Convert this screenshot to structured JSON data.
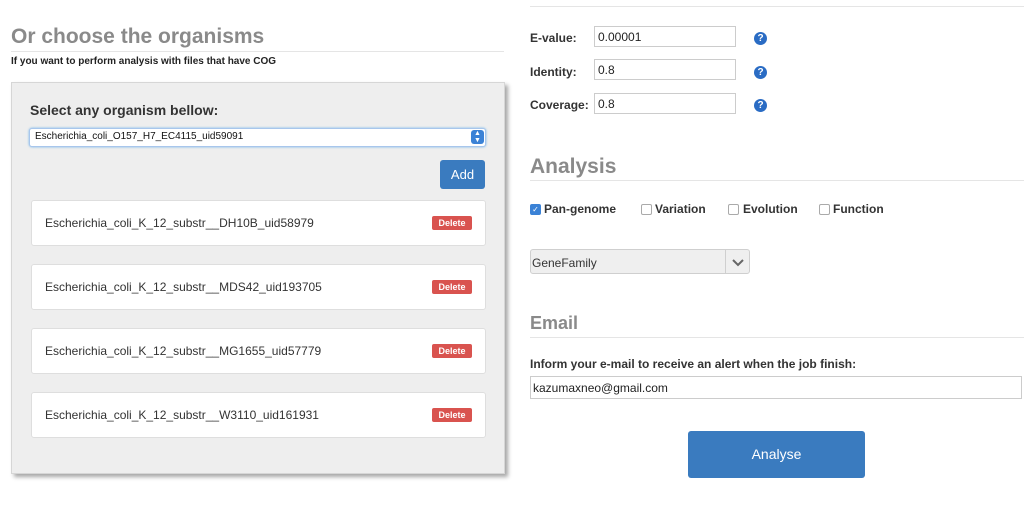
{
  "left": {
    "title": "Or choose the organisms",
    "subtitle": "If you want to perform analysis with files that have COG",
    "panel_label": "Select any organism bellow:",
    "selected_organism": "Escherichia_coli_O157_H7_EC4115_uid59091",
    "add_label": "Add",
    "delete_label": "Delete",
    "organisms": [
      "Escherichia_coli_K_12_substr__DH10B_uid58979",
      "Escherichia_coli_K_12_substr__MDS42_uid193705",
      "Escherichia_coli_K_12_substr__MG1655_uid57779",
      "Escherichia_coli_K_12_substr__W3110_uid161931"
    ]
  },
  "params": {
    "evalue_label": "E-value:",
    "evalue": "0.00001",
    "identity_label": "Identity:",
    "identity": "0.8",
    "coverage_label": "Coverage:",
    "coverage": "0.8",
    "help_icon": "question-circle-icon"
  },
  "analysis": {
    "title": "Analysis",
    "options": [
      {
        "label": "Pan-genome",
        "checked": true
      },
      {
        "label": "Variation",
        "checked": false
      },
      {
        "label": "Evolution",
        "checked": false
      },
      {
        "label": "Function",
        "checked": false
      }
    ],
    "selected_method": "GeneFamily"
  },
  "email": {
    "title": "Email",
    "description": "Inform your e-mail to receive an alert when the job finish:",
    "value": "kazumaxneo@gmail.com"
  },
  "analyse_label": "Analyse",
  "colors": {
    "primary": "#3a7bbf",
    "danger": "#d9534f",
    "help": "#2a6cc4",
    "heading": "#8a8a8a"
  }
}
